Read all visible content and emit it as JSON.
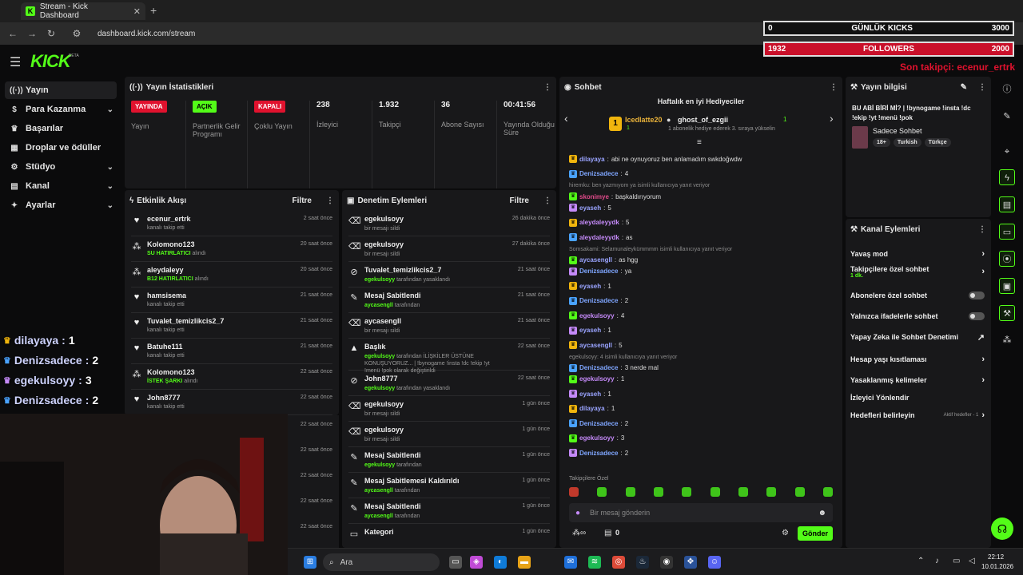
{
  "browser": {
    "tab_title": "Stream - Kick Dashboard",
    "url": "dashboard.kick.com/stream",
    "new_tab": "+",
    "tab_close": "✕"
  },
  "overlay": {
    "daily_label": "GÜNLÜK KICKS",
    "daily_left": "0",
    "daily_right": "3000",
    "followers_left": "1932",
    "followers_label": "FOLLOWERS",
    "followers_right": "2000",
    "last_follower": "Son takipçi: ecenur_ertrk"
  },
  "app": {
    "logo": "KICK",
    "logo_beta": "BETA"
  },
  "sidebar": {
    "items": [
      {
        "label": "Yayın"
      },
      {
        "label": "Para Kazanma"
      },
      {
        "label": "Başarılar"
      },
      {
        "label": "Droplar ve ödüller"
      },
      {
        "label": "Stüdyo"
      },
      {
        "label": "Kanal"
      },
      {
        "label": "Ayarlar"
      }
    ]
  },
  "stats": {
    "title": "Yayın İstatistikleri",
    "cols": [
      {
        "badge": "YAYINDA",
        "label": "Yayın"
      },
      {
        "badge": "AÇIK",
        "label": "Partnerlik Gelir Programı"
      },
      {
        "badge": "KAPALI",
        "label": "Çoklu Yayın"
      },
      {
        "value": "238",
        "label": "İzleyici"
      },
      {
        "value": "1.932",
        "label": "Takipçi"
      },
      {
        "value": "36",
        "label": "Abone Sayısı"
      },
      {
        "value": "00:41:56",
        "label": "Yayında Olduğu Süre"
      }
    ]
  },
  "activity": {
    "title": "Etkinlik Akışı",
    "filter": "Filtre",
    "rows": [
      {
        "name": "ecenur_ertrk",
        "sub": "kanalı takip etti",
        "hl": "",
        "time": "2 saat önce"
      },
      {
        "name": "Kolomono123",
        "sub": "alındı",
        "hl": "SU HATIRLATICI",
        "time": "20 saat önce"
      },
      {
        "name": "aleydaleyy",
        "sub": "alındı",
        "hl": "B12 HATIRLATICI",
        "time": "20 saat önce"
      },
      {
        "name": "hamsisema",
        "sub": "kanalı takip etti",
        "hl": "",
        "time": "21 saat önce"
      },
      {
        "name": "Tuvalet_temizlikcis2_7",
        "sub": "kanalı takip etti",
        "hl": "",
        "time": "21 saat önce"
      },
      {
        "name": "Batuhe111",
        "sub": "kanalı takip etti",
        "hl": "",
        "time": "21 saat önce"
      },
      {
        "name": "Kolomono123",
        "sub": "alındı",
        "hl": "İSTEK ŞARKI",
        "time": "22 saat önce"
      },
      {
        "name": "John8777",
        "sub": "kanalı takip etti",
        "hl": "",
        "time": "22 saat önce"
      }
    ],
    "extra_times": [
      "22 saat önce",
      "22 saat önce",
      "22 saat önce",
      "22 saat önce",
      "22 saat önce",
      "23 saat önce"
    ]
  },
  "moderation": {
    "title": "Denetim Eylemleri",
    "filter": "Filtre",
    "rows": [
      {
        "name": "egekulsoyy",
        "sub": "bir mesajı sildi",
        "hl": "",
        "time": "26 dakika önce"
      },
      {
        "name": "egekulsoyy",
        "sub": "bir mesajı sildi",
        "hl": "",
        "time": "27 dakika önce"
      },
      {
        "name": "Tuvalet_temizlikcis2_7",
        "sub": "tarafından yasaklandı",
        "hl": "egekulsoyy",
        "time": "21 saat önce"
      },
      {
        "name": "Mesaj Sabitlendi",
        "sub": "tarafından",
        "hl": "aycasengll",
        "time": "21 saat önce"
      },
      {
        "name": "aycasengll",
        "sub": "bir mesajı sildi",
        "hl": "",
        "time": "21 saat önce"
      },
      {
        "name": "Başlık",
        "sub": "tarafından İLİŞKİLER ÜSTÜNE KONUŞUYORUZ... | !bynogame !insta !dc !ekip !yt !menü !pok olarak değiştirildi",
        "hl": "egekulsoyy",
        "time": "22 saat önce"
      },
      {
        "name": "John8777",
        "sub": "tarafından yasaklandı",
        "hl": "egekulsoyy",
        "time": "22 saat önce"
      },
      {
        "name": "egekulsoyy",
        "sub": "bir mesajı sildi",
        "hl": "",
        "time": "1 gün önce"
      },
      {
        "name": "egekulsoyy",
        "sub": "bir mesajı sildi",
        "hl": "",
        "time": "1 gün önce"
      },
      {
        "name": "Mesaj Sabitlendi",
        "sub": "tarafından",
        "hl": "egekulsoyy",
        "time": "1 gün önce"
      },
      {
        "name": "Mesaj Sabitlemesi Kaldırıldı",
        "sub": "tarafından",
        "hl": "aycasengll",
        "time": "1 gün önce"
      },
      {
        "name": "Mesaj Sabitlendi",
        "sub": "tarafından",
        "hl": "aycasengll",
        "time": "1 gün önce"
      },
      {
        "name": "Kategori",
        "sub": "",
        "hl": "",
        "time": "1 gün önce"
      }
    ]
  },
  "chat": {
    "title": "Sohbet",
    "gifters_title": "Haftalık en iyi Hediyeciler",
    "gifter1": "Icedlatte20",
    "gifter1_count": "1",
    "gifter2": "ghost_of_ezgii",
    "gifter2_count": "1",
    "gift_hint": "1 abonelik hediye ederek 3. sıraya yükselin",
    "messages": [
      {
        "reply": "",
        "user": "dilayaya",
        "color": "#9aa4ff",
        "text": "abi ne oynuyoruz ben anlamadım swkdoğwdw"
      },
      {
        "reply": "",
        "user": "Denizsadece",
        "color": "#7fa6ff",
        "text": "4"
      },
      {
        "reply": "hiremku: ben yazmıyom ya isimli kullanıcıya yanıt veriyor",
        "user": "skonimye",
        "color": "#e04a8a",
        "text": "başkaldırıyorum"
      },
      {
        "reply": "",
        "user": "eyaseh",
        "color": "#9aa4ff",
        "text": "5"
      },
      {
        "reply": "",
        "user": "aleydaleyydk",
        "color": "#c58af9",
        "text": "5"
      },
      {
        "reply": "",
        "user": "aleydaleyydk",
        "color": "#c58af9",
        "text": "as"
      },
      {
        "reply": "Somsakami: Selamunaleykümmmm isimli kullanıcıya yanıt veriyor",
        "user": "aycasengll",
        "color": "#9aa4ff",
        "text": "as hgg"
      },
      {
        "reply": "",
        "user": "Denizsadece",
        "color": "#7fa6ff",
        "text": "ya"
      },
      {
        "reply": "",
        "user": "eyaseh",
        "color": "#9aa4ff",
        "text": "1"
      },
      {
        "reply": "",
        "user": "Denizsadece",
        "color": "#7fa6ff",
        "text": "2"
      },
      {
        "reply": "",
        "user": "egekulsoyy",
        "color": "#c58af9",
        "text": "4"
      },
      {
        "reply": "",
        "user": "eyaseh",
        "color": "#9aa4ff",
        "text": "1"
      },
      {
        "reply": "",
        "user": "aycasengll",
        "color": "#9aa4ff",
        "text": "5"
      },
      {
        "reply": "egekulsoyy: 4 isimli kullanıcıya yanıt veriyor",
        "user": "Denizsadece",
        "color": "#7fa6ff",
        "text": "3 nerde mal"
      },
      {
        "reply": "",
        "user": "egekulsoyy",
        "color": "#c58af9",
        "text": "1"
      },
      {
        "reply": "",
        "user": "eyaseh",
        "color": "#9aa4ff",
        "text": "1"
      },
      {
        "reply": "",
        "user": "dilayaya",
        "color": "#9aa4ff",
        "text": "1"
      },
      {
        "reply": "",
        "user": "Denizsadece",
        "color": "#7fa6ff",
        "text": "2"
      },
      {
        "reply": "",
        "user": "egekulsoyy",
        "color": "#c58af9",
        "text": "3"
      },
      {
        "reply": "",
        "user": "Denizsadece",
        "color": "#7fa6ff",
        "text": "2"
      }
    ],
    "followers_only": "Takipçilere Özel",
    "placeholder": "Bir mesaj gönderin",
    "points": "0",
    "send": "Gönder"
  },
  "streaminfo": {
    "title": "Yayın bilgisi",
    "stream_title": "BU ABİ BİRİ Mİ? | !bynogame !insta !dc !ekip !yt !menü !pok",
    "category": "Sadece Sohbet",
    "tags": [
      "18+",
      "Turkish",
      "Türkçe"
    ]
  },
  "channel": {
    "title": "Kanal Eylemleri",
    "items": [
      {
        "label": "Yavaş mod",
        "sub": "",
        "kind": "arrow"
      },
      {
        "label": "Takipçilere özel sohbet",
        "sub": "1 dk.",
        "kind": "arrow"
      },
      {
        "label": "Abonelere özel sohbet",
        "sub": "",
        "kind": "toggle"
      },
      {
        "label": "Yalnızca ifadelerle sohbet",
        "sub": "",
        "kind": "toggle"
      },
      {
        "label": "Yapay Zeka ile Sohbet Denetimi",
        "sub": "",
        "kind": "ext"
      },
      {
        "label": "Hesap yaşı kısıtlaması",
        "sub": "",
        "kind": "arrow"
      },
      {
        "label": "Yasaklanmış kelimeler",
        "sub": "",
        "kind": "arrow"
      },
      {
        "label": "İzleyici Yönlendir",
        "sub": "",
        "kind": "none"
      },
      {
        "label": "Hedefleri belirleyin",
        "sub": "Aktif hedefler - 1",
        "kind": "arrow"
      }
    ]
  },
  "overlay_counts": [
    {
      "user": "dilayaya",
      "count": "1"
    },
    {
      "user": "Denizsadece",
      "count": "2"
    },
    {
      "user": "egekulsoyy",
      "count": "3"
    },
    {
      "user": "Denizsadece",
      "count": "2"
    }
  ],
  "taskbar": {
    "search": "Ara",
    "time": "22:12",
    "date": "10.01.2026"
  }
}
